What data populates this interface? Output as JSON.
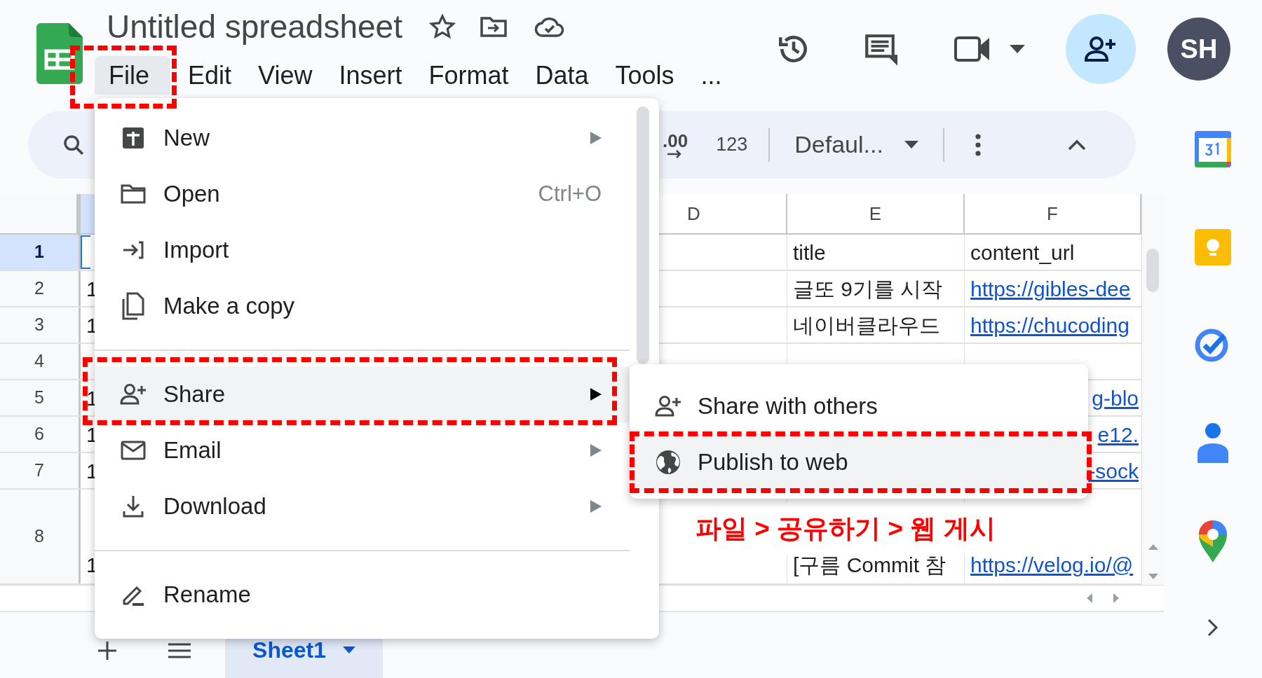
{
  "document": {
    "title": "Untitled spreadsheet"
  },
  "menu_bar": [
    {
      "label": "File",
      "selected": true
    },
    {
      "label": "Edit",
      "selected": false
    },
    {
      "label": "View",
      "selected": false
    },
    {
      "label": "Insert",
      "selected": false
    },
    {
      "label": "Format",
      "selected": false
    },
    {
      "label": "Data",
      "selected": false
    },
    {
      "label": "Tools",
      "selected": false
    },
    {
      "label": "...",
      "selected": false
    }
  ],
  "account": {
    "initials": "SH"
  },
  "toolbar": {
    "decimal_button": ".00",
    "number_format_button": "123",
    "font_select": "Defaul..."
  },
  "grid": {
    "columns": [
      "D",
      "E",
      "F"
    ],
    "rows": [
      {
        "number": "1",
        "selected": true,
        "a": "",
        "e": "title",
        "f": "content_url",
        "f_link": false,
        "f_partial": false
      },
      {
        "number": "2",
        "selected": false,
        "a": "1",
        "e": "글또 9기를 시작",
        "f": "https://gibles-dee",
        "f_link": true,
        "f_partial": false
      },
      {
        "number": "3",
        "selected": false,
        "a": "1",
        "e": "네이버클라우드",
        "f": "https://chucoding",
        "f_link": true,
        "f_partial": false
      },
      {
        "number": "4",
        "selected": false
      },
      {
        "number": "5",
        "selected": false,
        "a": "1",
        "e": "",
        "f": "g-blo",
        "f_link": true,
        "f_partial": true
      },
      {
        "number": "6",
        "selected": false,
        "a": "1",
        "e": "",
        "f": "e12.",
        "f_link": true,
        "f_partial": true
      },
      {
        "number": "7",
        "selected": false,
        "a": "1",
        "e": "",
        "f": "-sock",
        "f_link": true,
        "f_partial": true
      },
      {
        "number": "8",
        "selected": false,
        "a": "1",
        "e": "[구름 Commit 참",
        "f": "https://velog.io/@",
        "f_link": true,
        "f_partial": false
      }
    ]
  },
  "file_menu": [
    {
      "kind": "item",
      "label": "New",
      "submenu": true,
      "selected": false
    },
    {
      "kind": "item",
      "label": "Open",
      "shortcut": "Ctrl+O",
      "submenu": false,
      "selected": false
    },
    {
      "kind": "item",
      "label": "Import",
      "submenu": false,
      "selected": false
    },
    {
      "kind": "item",
      "label": "Make a copy",
      "submenu": false,
      "selected": false
    },
    {
      "kind": "divider"
    },
    {
      "kind": "item",
      "label": "Share",
      "submenu": true,
      "selected": true
    },
    {
      "kind": "item",
      "label": "Email",
      "submenu": true,
      "selected": false
    },
    {
      "kind": "item",
      "label": "Download",
      "submenu": true,
      "selected": false
    },
    {
      "kind": "divider"
    },
    {
      "kind": "item",
      "label": "Rename",
      "submenu": false,
      "selected": false
    }
  ],
  "share_submenu": [
    {
      "label": "Share with others",
      "selected": false
    },
    {
      "label": "Publish to web",
      "selected": true
    }
  ],
  "annotation": "파일 > 공유하기 > 웹 게시",
  "sheet_tabs": [
    {
      "label": "Sheet1",
      "selected": true
    }
  ]
}
